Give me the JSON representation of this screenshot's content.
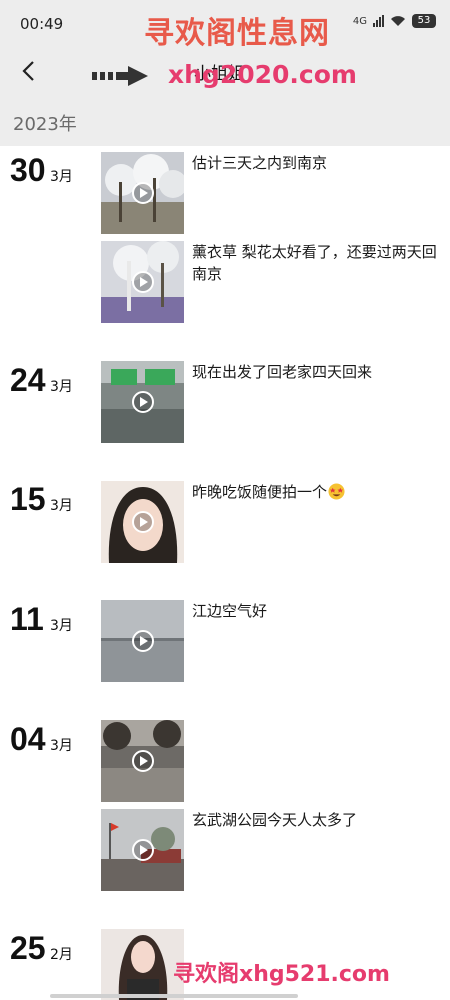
{
  "status": {
    "time": "00:49",
    "network": "4G",
    "battery": "53"
  },
  "header": {
    "title": "小姐姐"
  },
  "watermark": {
    "top_title": "寻欢阁性息网",
    "top_url": "xhg2020.com",
    "bottom": "寻欢阁xhg521.com"
  },
  "year": "2023年",
  "groups": [
    {
      "day": "30",
      "month": "3月",
      "posts": [
        {
          "caption": "估计三天之内到南京"
        },
        {
          "caption": "薰衣草 梨花太好看了，还要过两天回南京"
        }
      ]
    },
    {
      "day": "24",
      "month": "3月",
      "posts": [
        {
          "caption": "现在出发了回老家四天回来"
        }
      ]
    },
    {
      "day": "15",
      "month": "3月",
      "posts": [
        {
          "caption": "昨晚吃饭随便拍一个"
        }
      ]
    },
    {
      "day": "11",
      "month": "3月",
      "posts": [
        {
          "caption": "江边空气好"
        }
      ]
    },
    {
      "day": "04",
      "month": "3月",
      "posts": [
        {
          "caption": ""
        },
        {
          "caption": "玄武湖公园今天人太多了"
        }
      ]
    },
    {
      "day": "25",
      "month": "2月",
      "posts": []
    }
  ],
  "icons": {
    "back": "back-arrow-icon",
    "play": "play-icon",
    "emoji": "star-struck-emoji-icon"
  },
  "colors": {
    "header_bg": "#ededed",
    "watermark_red": "#e85a4a",
    "watermark_pink": "#e63c6e"
  }
}
